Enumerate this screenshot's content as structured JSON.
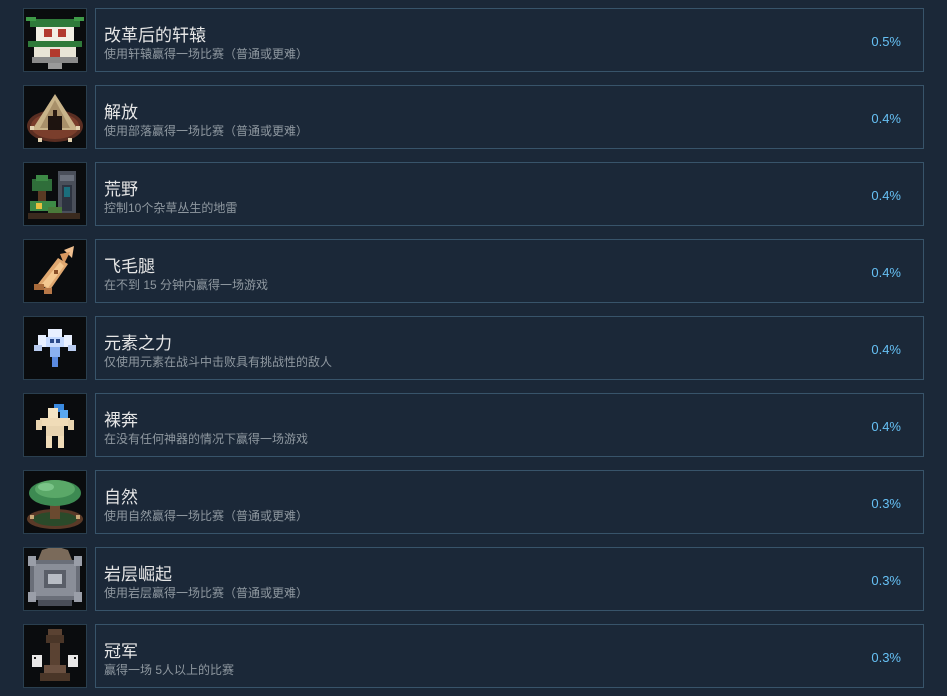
{
  "achievements": [
    {
      "title": "改革后的轩辕",
      "description": "使用轩辕赢得一场比赛（普通或更难）",
      "percent": "0.5%",
      "icon": "chinese-palace-icon"
    },
    {
      "title": "解放",
      "description": "使用部落赢得一场比赛（普通或更难）",
      "percent": "0.4%",
      "icon": "tribal-tent-icon"
    },
    {
      "title": "荒野",
      "description": "控制10个杂草丛生的地雷",
      "percent": "0.4%",
      "icon": "overgrown-ruins-icon"
    },
    {
      "title": "飞毛腿",
      "description": "在不到 15 分钟内赢得一场游戏",
      "percent": "0.4%",
      "icon": "winged-boot-icon"
    },
    {
      "title": "元素之力",
      "description": "仅使用元素在战斗中击败具有挑战性的敌人",
      "percent": "0.4%",
      "icon": "elemental-spirit-icon"
    },
    {
      "title": "裸奔",
      "description": "在没有任何神器的情况下赢得一场游戏",
      "percent": "0.4%",
      "icon": "unarmored-hero-icon"
    },
    {
      "title": "自然",
      "description": "使用自然赢得一场比赛（普通或更难）",
      "percent": "0.3%",
      "icon": "great-tree-icon"
    },
    {
      "title": "岩层崛起",
      "description": "使用岩层赢得一场比赛（普通或更难）",
      "percent": "0.3%",
      "icon": "stone-fortress-icon"
    },
    {
      "title": "冠军",
      "description": "赢得一场 5人以上的比赛",
      "percent": "0.3%",
      "icon": "throne-icon"
    }
  ],
  "colors": {
    "background": "#1b2838",
    "panel_border": "#38546a",
    "title": "#e6e6e6",
    "description": "#8f98a0",
    "percent": "#66c0f4"
  }
}
